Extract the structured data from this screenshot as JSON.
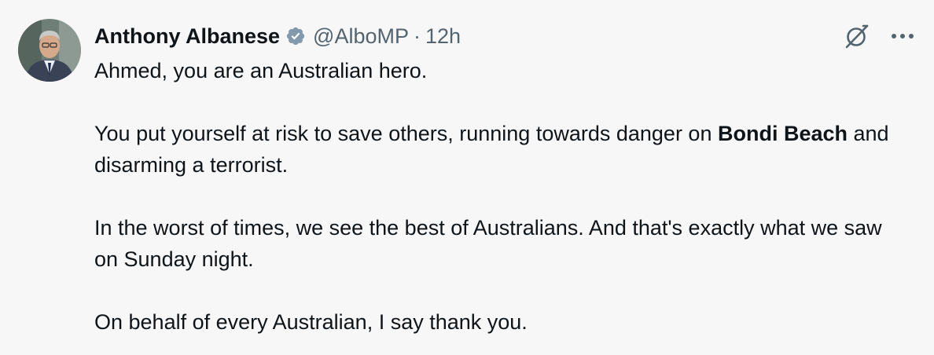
{
  "tweet": {
    "author_name": "Anthony Albanese",
    "handle": "@AlboMP",
    "separator": "·",
    "time": "12h",
    "verified_icon": "verified-badge-icon",
    "actions": {
      "grok_icon": "grok-icon",
      "more_icon": "more-icon"
    },
    "paragraphs": {
      "p1": "Ahmed, you are an Australian hero.",
      "p2_before": "You put yourself at risk to save others, running towards danger on ",
      "p2_bold": "Bondi Beach",
      "p2_after": " and disarming a terrorist.",
      "p3": "In the worst of times, we see the best of Australians. And that's exactly what we saw on Sunday night.",
      "p4": "On behalf of every Australian, I say thank you."
    }
  },
  "colors": {
    "background": "#f7f7f7",
    "text": "#0f1419",
    "secondary_text": "#536471",
    "verified_badge": "#829aab"
  }
}
